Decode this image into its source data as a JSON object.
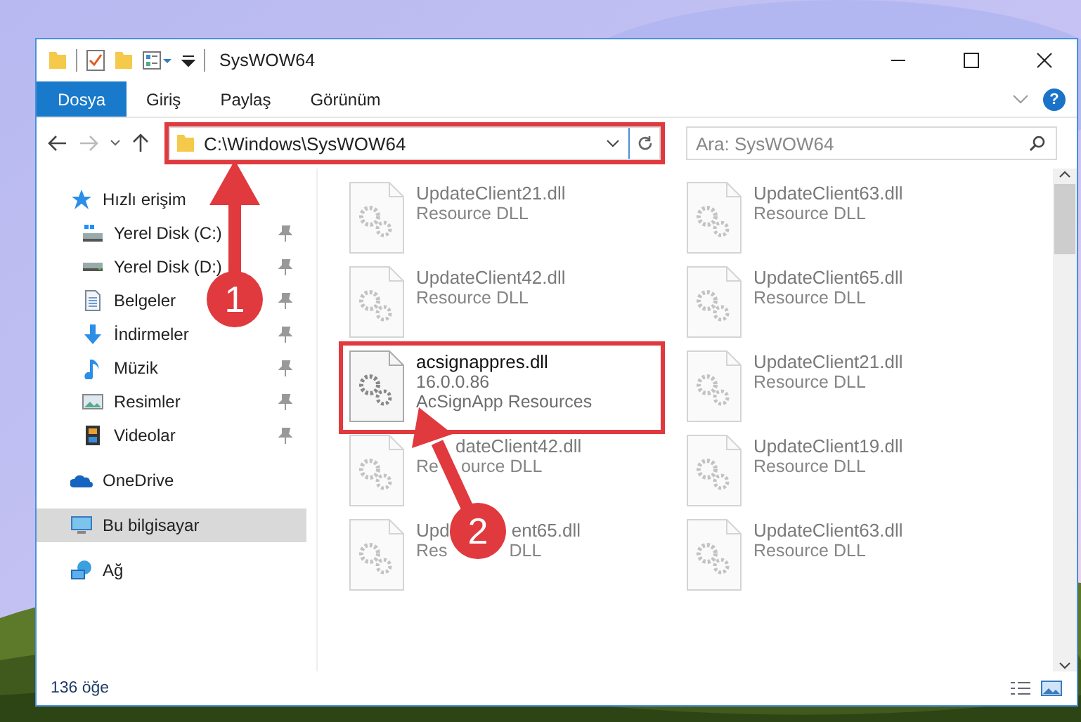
{
  "window": {
    "title": "SysWOW64"
  },
  "ribbon": {
    "tabs": [
      {
        "label": "Dosya",
        "selected": true
      },
      {
        "label": "Giriş",
        "selected": false
      },
      {
        "label": "Paylaş",
        "selected": false
      },
      {
        "label": "Görünüm",
        "selected": false
      }
    ],
    "help": "?"
  },
  "address": {
    "path": "C:\\Windows\\SysWOW64",
    "highlighted": true
  },
  "search": {
    "placeholder": "Ara: SysWOW64"
  },
  "sidebar": {
    "items": [
      {
        "label": "Hızlı erişim",
        "kind": "star",
        "pinned": false,
        "selected": false,
        "children": [
          {
            "label": "Yerel Disk (C:)",
            "kind": "system-drive",
            "pinned": true,
            "selected": false
          },
          {
            "label": "Yerel Disk (D:)",
            "kind": "drive",
            "pinned": true,
            "selected": false
          },
          {
            "label": "Belgeler",
            "kind": "documents",
            "pinned": true,
            "selected": false
          },
          {
            "label": "İndirmeler",
            "kind": "download",
            "pinned": true,
            "selected": false
          },
          {
            "label": "Müzik",
            "kind": "music",
            "pinned": true,
            "selected": false
          },
          {
            "label": "Resimler",
            "kind": "pictures",
            "pinned": true,
            "selected": false
          },
          {
            "label": "Videolar",
            "kind": "videos",
            "pinned": true,
            "selected": false
          }
        ]
      },
      {
        "label": "OneDrive",
        "kind": "cloud",
        "pinned": false,
        "selected": false
      },
      {
        "label": "Bu bilgisayar",
        "kind": "computer",
        "pinned": false,
        "selected": true
      },
      {
        "label": "Ağ",
        "kind": "network",
        "pinned": false,
        "selected": false
      }
    ]
  },
  "files": [
    {
      "kind": "plain",
      "name_parts": [
        "UpdateClient21.dll"
      ],
      "line_parts": [
        [
          "Resource DLL"
        ]
      ],
      "blurred": true,
      "highlighted": false
    },
    {
      "kind": "plain",
      "name_parts": [
        "UpdateClient63.dll"
      ],
      "line_parts": [
        [
          "Resource DLL"
        ]
      ],
      "blurred": true,
      "highlighted": false
    },
    {
      "kind": "plain",
      "name_parts": [
        "UpdateClient42.dll"
      ],
      "line_parts": [
        [
          "Resource DLL"
        ]
      ],
      "blurred": true,
      "highlighted": false
    },
    {
      "kind": "plain",
      "name_parts": [
        "UpdateClient65.dll"
      ],
      "line_parts": [
        [
          "Resource DLL"
        ]
      ],
      "blurred": true,
      "highlighted": false
    },
    {
      "kind": "plain",
      "name_parts": [
        "acsignappres.dll"
      ],
      "line_parts": [
        [
          "16.0.0.86"
        ],
        [
          "AcSignApp Resources"
        ]
      ],
      "blurred": false,
      "highlighted": true
    },
    {
      "kind": "plain",
      "name_parts": [
        "UpdateClient21.dll"
      ],
      "line_parts": [
        [
          "Resource DLL"
        ]
      ],
      "blurred": true,
      "highlighted": false
    },
    {
      "kind": "under-arrow",
      "name_parts": [
        "dateClient42.dll"
      ],
      "line_parts": [
        [
          "Re",
          "ource DLL"
        ]
      ],
      "blurred": true,
      "highlighted": false
    },
    {
      "kind": "plain",
      "name_parts": [
        "UpdateClient19.dll"
      ],
      "line_parts": [
        [
          "Resource DLL"
        ]
      ],
      "blurred": true,
      "highlighted": false
    },
    {
      "kind": "under-badge",
      "name_parts": [
        "Upd",
        "ent65.dll"
      ],
      "line_parts": [
        [
          "Res",
          "DLL"
        ]
      ],
      "blurred": true,
      "highlighted": false
    },
    {
      "kind": "plain",
      "name_parts": [
        "UpdateClient63.dll"
      ],
      "line_parts": [
        [
          "Resource DLL"
        ]
      ],
      "blurred": true,
      "highlighted": false
    }
  ],
  "status_bar": {
    "count": "136 öğe"
  },
  "callouts": [
    {
      "number": "1"
    },
    {
      "number": "2"
    }
  ]
}
